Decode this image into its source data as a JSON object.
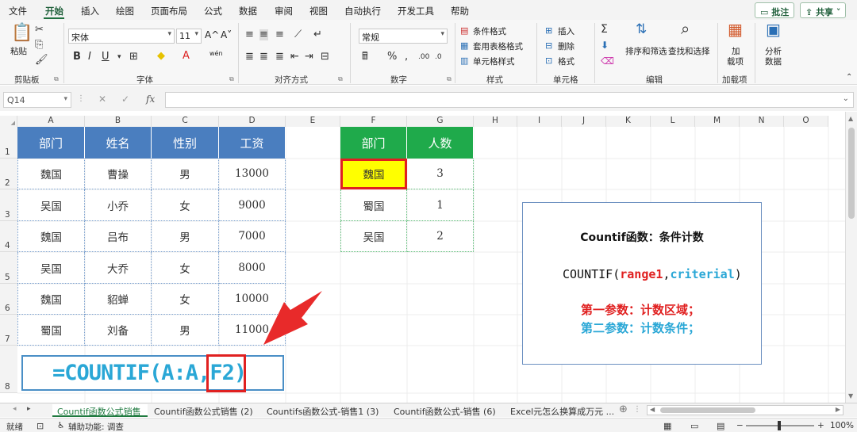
{
  "menu": {
    "items": [
      "文件",
      "开始",
      "插入",
      "绘图",
      "页面布局",
      "公式",
      "数据",
      "审阅",
      "视图",
      "自动执行",
      "开发工具",
      "帮助"
    ],
    "comment_btn": "批注",
    "share_btn": "共享"
  },
  "ribbon": {
    "clipboard": {
      "paste": "粘贴",
      "label": "剪贴板"
    },
    "font": {
      "name": "宋体",
      "size": "11",
      "grow": "A^",
      "shrink": "A˅",
      "wen": "wén",
      "label": "字体"
    },
    "align": {
      "label": "对齐方式"
    },
    "number": {
      "format": "常规",
      "label": "数字"
    },
    "styles": {
      "cond": "条件格式",
      "table": "套用表格格式",
      "cell": "单元格样式",
      "label": "样式"
    },
    "cells": {
      "insert": "插入",
      "delete": "删除",
      "format": "格式",
      "label": "单元格"
    },
    "editing": {
      "sort": "排序和筛选",
      "find": "查找和选择",
      "label": "编辑"
    },
    "addins": {
      "line1": "加",
      "line2": "载项",
      "label": "加载项"
    },
    "analysis": {
      "line1": "分析",
      "line2": "数据"
    }
  },
  "formula_bar": {
    "name_box": "Q14",
    "fx": "fx"
  },
  "columns": [
    "A",
    "B",
    "C",
    "D",
    "E",
    "F",
    "G",
    "H",
    "I",
    "J",
    "K",
    "L",
    "M",
    "N",
    "O"
  ],
  "rows": [
    "1",
    "2",
    "3",
    "4",
    "5",
    "6",
    "7",
    "8"
  ],
  "table1": {
    "headers": [
      "部门",
      "姓名",
      "性别",
      "工资"
    ],
    "rows": [
      [
        "魏国",
        "曹操",
        "男",
        "13000"
      ],
      [
        "吴国",
        "小乔",
        "女",
        "9000"
      ],
      [
        "魏国",
        "吕布",
        "男",
        "7000"
      ],
      [
        "吴国",
        "大乔",
        "女",
        "8000"
      ],
      [
        "魏国",
        "貂蝉",
        "女",
        "10000"
      ],
      [
        "蜀国",
        "刘备",
        "男",
        "11000"
      ]
    ]
  },
  "table2": {
    "headers": [
      "部门",
      "人数"
    ],
    "rows": [
      [
        "魏国",
        "3"
      ],
      [
        "蜀国",
        "1"
      ],
      [
        "吴国",
        "2"
      ]
    ]
  },
  "formula_box": {
    "part1": "=COUNTIF(A:A",
    "part2": ",F2",
    "part3": ")"
  },
  "note": {
    "title": "Countif函数：条件计数",
    "syntax_pre": "COUNTIF(",
    "syntax_arg1": "range1",
    "syntax_comma": ",",
    "syntax_arg2": "criterial",
    "syntax_post": ")",
    "line1": "第一参数：计数区域；",
    "line2": "第二参数：计数条件；"
  },
  "sheet_tabs": [
    "Countif函数公式销售",
    "Countif函数公式销售 (2)",
    "Countifs函数公式-销售1 (3)",
    "Countif函数公式-销售 (6)",
    "Excel元怎么换算成万元 ..."
  ],
  "status": {
    "ready": "就绪",
    "accessibility": "辅助功能: 调查",
    "zoom": "100%"
  },
  "colors": {
    "header_blue": "#4a7ebf",
    "header_green": "#1faa4b",
    "highlight_yellow": "#ffff00",
    "red": "#e02020",
    "cyan": "#2aa7d6"
  }
}
